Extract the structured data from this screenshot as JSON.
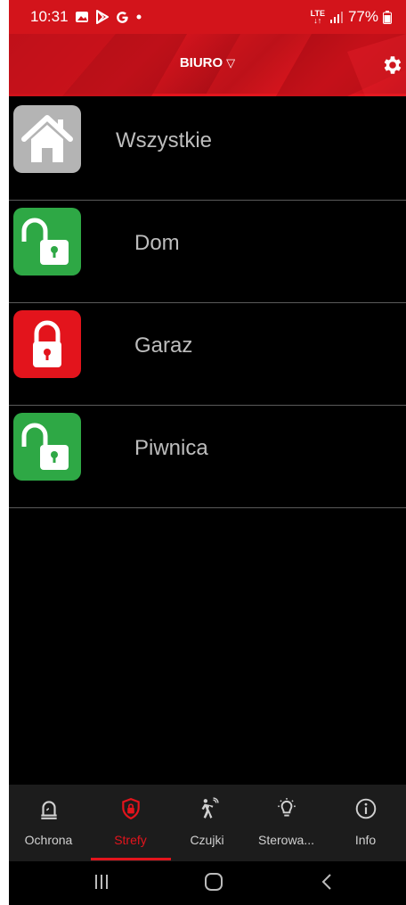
{
  "status_bar": {
    "time": "10:31",
    "network": "LTE",
    "battery": "77%"
  },
  "header": {
    "title": "BIURO",
    "dropdown_glyph": "▽"
  },
  "zones": [
    {
      "label": "Wszystkie",
      "icon": "home-icon",
      "color": "#b4b4b4"
    },
    {
      "label": "Dom",
      "icon": "unlocked-icon",
      "color": "#2ea845"
    },
    {
      "label": "Garaz",
      "icon": "locked-icon",
      "color": "#e3141c"
    },
    {
      "label": "Piwnica",
      "icon": "unlocked-icon",
      "color": "#2ea845"
    }
  ],
  "bottom_nav": [
    {
      "label": "Ochrona",
      "icon": "bell-icon"
    },
    {
      "label": "Strefy",
      "icon": "shield-lock-icon",
      "active": true
    },
    {
      "label": "Czujki",
      "icon": "motion-sensor-icon"
    },
    {
      "label": "Sterowa...",
      "icon": "light-bulb-icon"
    },
    {
      "label": "Info",
      "icon": "info-icon"
    }
  ],
  "colors": {
    "accent": "#e3141c",
    "status_bar": "#d3141b",
    "background": "#000000"
  }
}
